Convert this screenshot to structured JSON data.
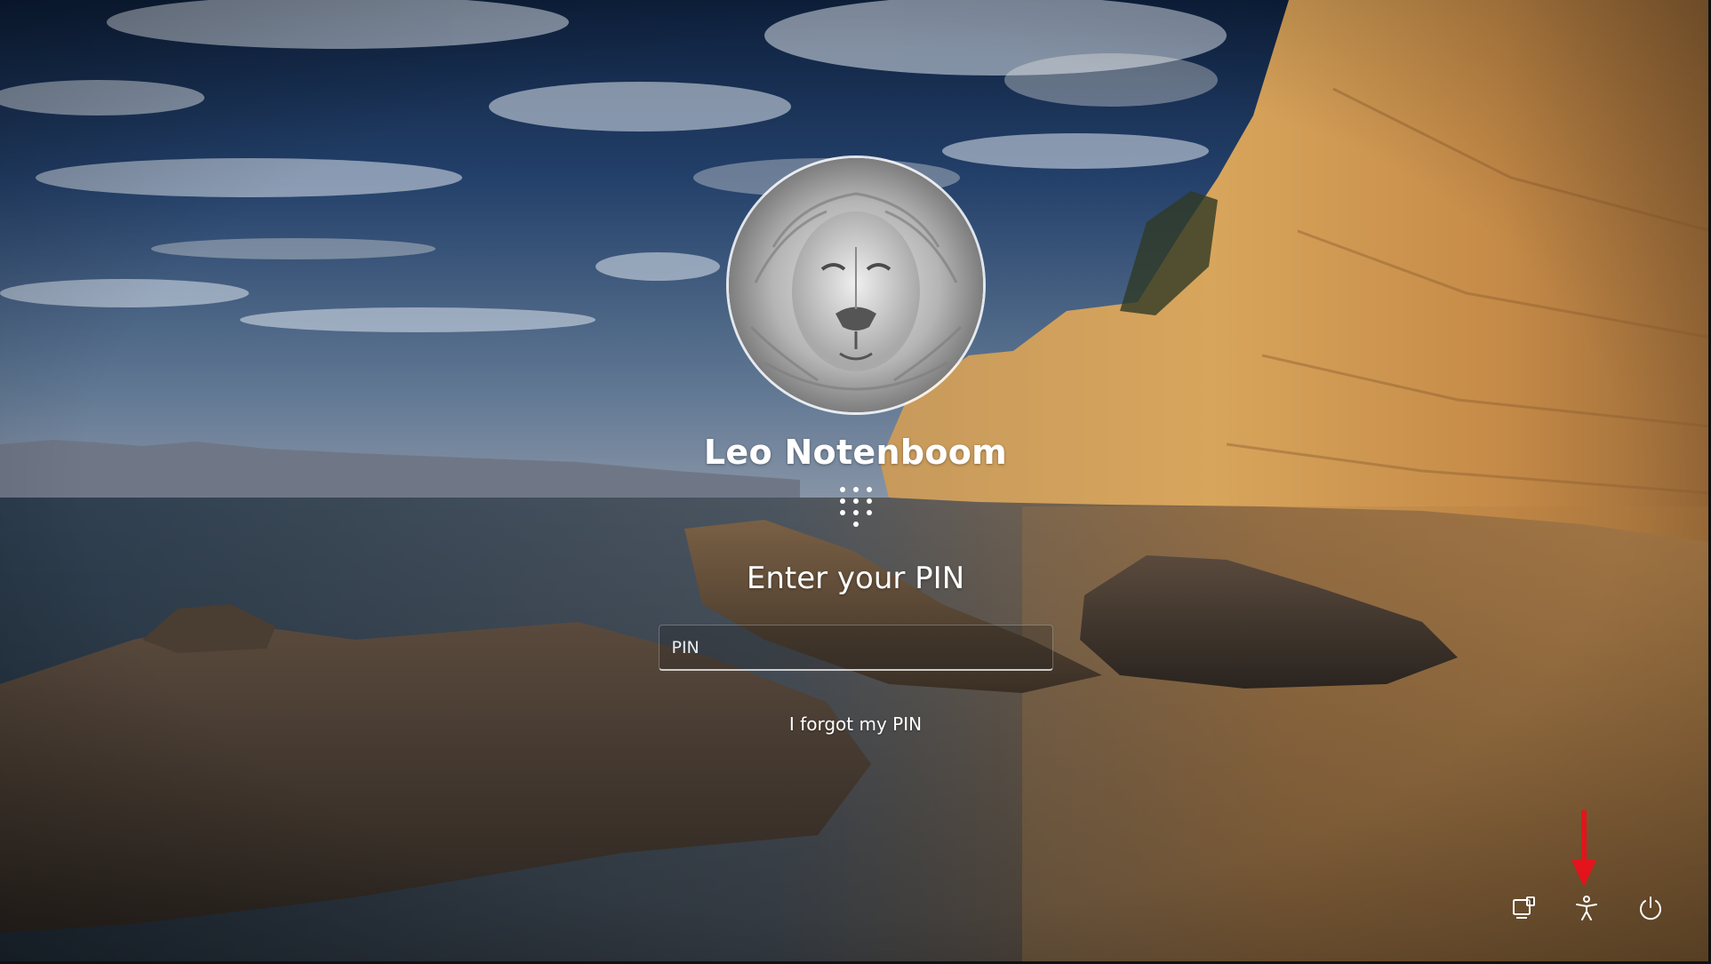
{
  "login": {
    "user_name": "Leo Notenboom",
    "prompt": "Enter your PIN",
    "pin_placeholder": "PIN",
    "forgot_pin_label": "I forgot my PIN"
  },
  "bottom_right_icons": [
    "network-icon",
    "accessibility-icon",
    "power-icon"
  ],
  "annotation_color": "#e3141b",
  "colors": {
    "text": "#ffffff"
  }
}
